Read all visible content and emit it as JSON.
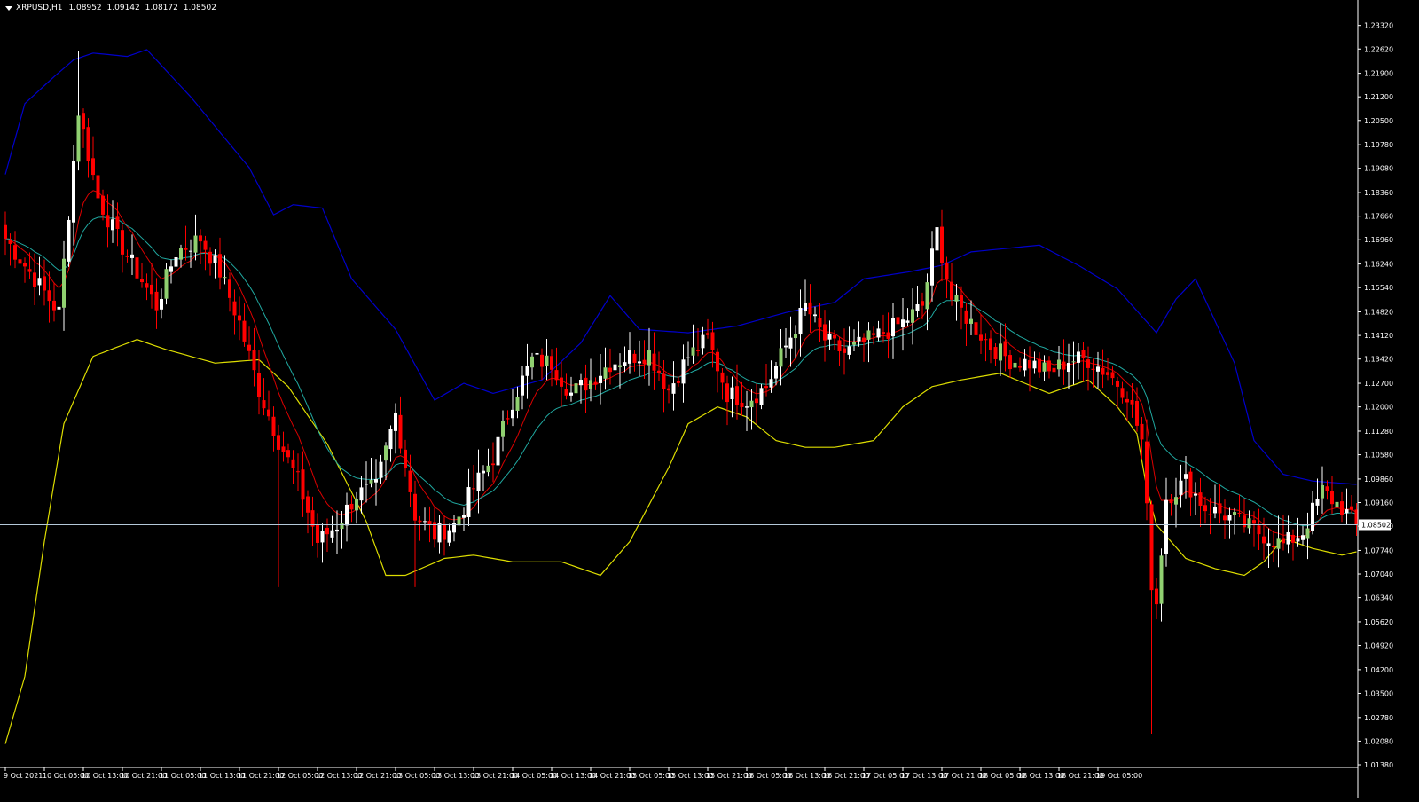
{
  "header": {
    "symbol": "XRPUSD,H1",
    "open": "1.08952",
    "high": "1.09142",
    "low": "1.08172",
    "close": "1.08502"
  },
  "current_price_label": "1.08502",
  "colors": {
    "background": "#000000",
    "bull_candle": "#ffffff",
    "bull_candle_alt": "#90d070",
    "bear_candle": "#ff0000",
    "upper_band": "#0000cc",
    "lower_band": "#dddd00",
    "ema_fast": "#dd0000",
    "ema_slow": "#20a8a0",
    "price_line": "#b4c8d8",
    "axis": "#ffffff"
  },
  "chart_data": {
    "type": "candlestick",
    "symbol": "XRPUSD",
    "timeframe": "H1",
    "ylim": [
      1.0138,
      1.2368
    ],
    "y_ticks": [
      "1.23320",
      "1.22620",
      "1.21900",
      "1.21200",
      "1.20500",
      "1.19780",
      "1.19080",
      "1.18360",
      "1.17660",
      "1.16960",
      "1.16240",
      "1.15540",
      "1.14820",
      "1.14120",
      "1.13420",
      "1.12700",
      "1.12000",
      "1.11280",
      "1.10580",
      "1.09860",
      "1.09160",
      "1.08460",
      "1.07740",
      "1.07040",
      "1.06340",
      "1.05620",
      "1.04920",
      "1.04200",
      "1.03500",
      "1.02780",
      "1.02080",
      "1.01380"
    ],
    "x_ticks": [
      "9 Oct 2021",
      "10 Oct 05:00",
      "10 Oct 13:00",
      "10 Oct 21:00",
      "11 Oct 05:00",
      "11 Oct 13:00",
      "11 Oct 21:00",
      "12 Oct 05:00",
      "12 Oct 13:00",
      "12 Oct 21:00",
      "13 Oct 05:00",
      "13 Oct 13:00",
      "13 Oct 21:00",
      "14 Oct 05:00",
      "14 Oct 13:00",
      "14 Oct 21:00",
      "15 Oct 05:00",
      "15 Oct 13:00",
      "15 Oct 21:00",
      "16 Oct 05:00",
      "16 Oct 13:00",
      "16 Oct 21:00",
      "17 Oct 05:00",
      "17 Oct 13:00",
      "17 Oct 21:00",
      "18 Oct 05:00",
      "18 Oct 13:00",
      "18 Oct 21:00",
      "19 Oct 05:00"
    ],
    "current_price": 1.08502,
    "candles_per_tick": 8,
    "price_path": [
      [
        0,
        1.17
      ],
      [
        6,
        1.158
      ],
      [
        11,
        1.148
      ],
      [
        15,
        1.208
      ],
      [
        19,
        1.182
      ],
      [
        23,
        1.17
      ],
      [
        27,
        1.16
      ],
      [
        31,
        1.15
      ],
      [
        35,
        1.166
      ],
      [
        40,
        1.17
      ],
      [
        44,
        1.16
      ],
      [
        48,
        1.145
      ],
      [
        52,
        1.125
      ],
      [
        56,
        1.11
      ],
      [
        60,
        1.098
      ],
      [
        64,
        1.08
      ],
      [
        68,
        1.085
      ],
      [
        72,
        1.094
      ],
      [
        76,
        1.096
      ],
      [
        80,
        1.118
      ],
      [
        84,
        1.088
      ],
      [
        88,
        1.082
      ],
      [
        92,
        1.085
      ],
      [
        96,
        1.096
      ],
      [
        100,
        1.105
      ],
      [
        104,
        1.122
      ],
      [
        108,
        1.134
      ],
      [
        112,
        1.133
      ],
      [
        116,
        1.124
      ],
      [
        120,
        1.128
      ],
      [
        124,
        1.133
      ],
      [
        128,
        1.135
      ],
      [
        132,
        1.136
      ],
      [
        136,
        1.125
      ],
      [
        140,
        1.135
      ],
      [
        144,
        1.14
      ],
      [
        148,
        1.124
      ],
      [
        152,
        1.122
      ],
      [
        156,
        1.126
      ],
      [
        160,
        1.138
      ],
      [
        164,
        1.15
      ],
      [
        168,
        1.14
      ],
      [
        172,
        1.136
      ],
      [
        176,
        1.139
      ],
      [
        180,
        1.142
      ],
      [
        184,
        1.145
      ],
      [
        188,
        1.15
      ],
      [
        191,
        1.172
      ],
      [
        194,
        1.152
      ],
      [
        198,
        1.145
      ],
      [
        202,
        1.138
      ],
      [
        206,
        1.134
      ],
      [
        210,
        1.133
      ],
      [
        214,
        1.13
      ],
      [
        218,
        1.134
      ],
      [
        222,
        1.134
      ],
      [
        226,
        1.13
      ],
      [
        230,
        1.124
      ],
      [
        233,
        1.11
      ],
      [
        235,
        1.068
      ],
      [
        236,
        1.062
      ],
      [
        238,
        1.093
      ],
      [
        242,
        1.098
      ],
      [
        246,
        1.09
      ],
      [
        250,
        1.088
      ],
      [
        254,
        1.085
      ],
      [
        258,
        1.082
      ],
      [
        262,
        1.079
      ],
      [
        266,
        1.083
      ],
      [
        270,
        1.095
      ],
      [
        274,
        1.09
      ],
      [
        277,
        1.08502
      ]
    ],
    "extreme_wicks": [
      [
        15,
        1.2255
      ],
      [
        56,
        1.0665
      ],
      [
        84,
        1.0665
      ],
      [
        191,
        1.184
      ],
      [
        235,
        1.023
      ]
    ],
    "bands": {
      "upper": [
        [
          0,
          1.189
        ],
        [
          4,
          1.21
        ],
        [
          10,
          1.218
        ],
        [
          14,
          1.223
        ],
        [
          18,
          1.225
        ],
        [
          25,
          1.224
        ],
        [
          29,
          1.226
        ],
        [
          38,
          1.212
        ],
        [
          50,
          1.191
        ],
        [
          55,
          1.177
        ],
        [
          59,
          1.18
        ],
        [
          65,
          1.179
        ],
        [
          71,
          1.158
        ],
        [
          80,
          1.143
        ],
        [
          88,
          1.122
        ],
        [
          94,
          1.127
        ],
        [
          100,
          1.124
        ],
        [
          110,
          1.128
        ],
        [
          118,
          1.139
        ],
        [
          124,
          1.153
        ],
        [
          130,
          1.143
        ],
        [
          140,
          1.142
        ],
        [
          150,
          1.144
        ],
        [
          160,
          1.148
        ],
        [
          170,
          1.151
        ],
        [
          176,
          1.158
        ],
        [
          185,
          1.16
        ],
        [
          192,
          1.162
        ],
        [
          198,
          1.166
        ],
        [
          212,
          1.168
        ],
        [
          220,
          1.162
        ],
        [
          228,
          1.155
        ],
        [
          236,
          1.142
        ],
        [
          240,
          1.152
        ],
        [
          244,
          1.158
        ],
        [
          252,
          1.133
        ],
        [
          256,
          1.11
        ],
        [
          262,
          1.1
        ],
        [
          268,
          1.098
        ],
        [
          277,
          1.097
        ]
      ],
      "lower": [
        [
          0,
          1.02
        ],
        [
          4,
          1.04
        ],
        [
          8,
          1.08
        ],
        [
          12,
          1.115
        ],
        [
          18,
          1.135
        ],
        [
          27,
          1.14
        ],
        [
          33,
          1.137
        ],
        [
          43,
          1.133
        ],
        [
          52,
          1.134
        ],
        [
          58,
          1.126
        ],
        [
          66,
          1.109
        ],
        [
          74,
          1.086
        ],
        [
          78,
          1.07
        ],
        [
          82,
          1.07
        ],
        [
          90,
          1.075
        ],
        [
          96,
          1.076
        ],
        [
          104,
          1.074
        ],
        [
          114,
          1.074
        ],
        [
          122,
          1.07
        ],
        [
          128,
          1.08
        ],
        [
          136,
          1.102
        ],
        [
          140,
          1.115
        ],
        [
          146,
          1.12
        ],
        [
          152,
          1.117
        ],
        [
          158,
          1.11
        ],
        [
          164,
          1.108
        ],
        [
          170,
          1.108
        ],
        [
          178,
          1.11
        ],
        [
          184,
          1.12
        ],
        [
          190,
          1.126
        ],
        [
          196,
          1.128
        ],
        [
          204,
          1.13
        ],
        [
          214,
          1.124
        ],
        [
          222,
          1.128
        ],
        [
          228,
          1.12
        ],
        [
          232,
          1.112
        ],
        [
          234,
          1.096
        ],
        [
          236,
          1.085
        ],
        [
          242,
          1.075
        ],
        [
          248,
          1.072
        ],
        [
          254,
          1.07
        ],
        [
          258,
          1.074
        ],
        [
          262,
          1.081
        ],
        [
          268,
          1.078
        ],
        [
          274,
          1.076
        ],
        [
          277,
          1.077
        ]
      ]
    }
  }
}
